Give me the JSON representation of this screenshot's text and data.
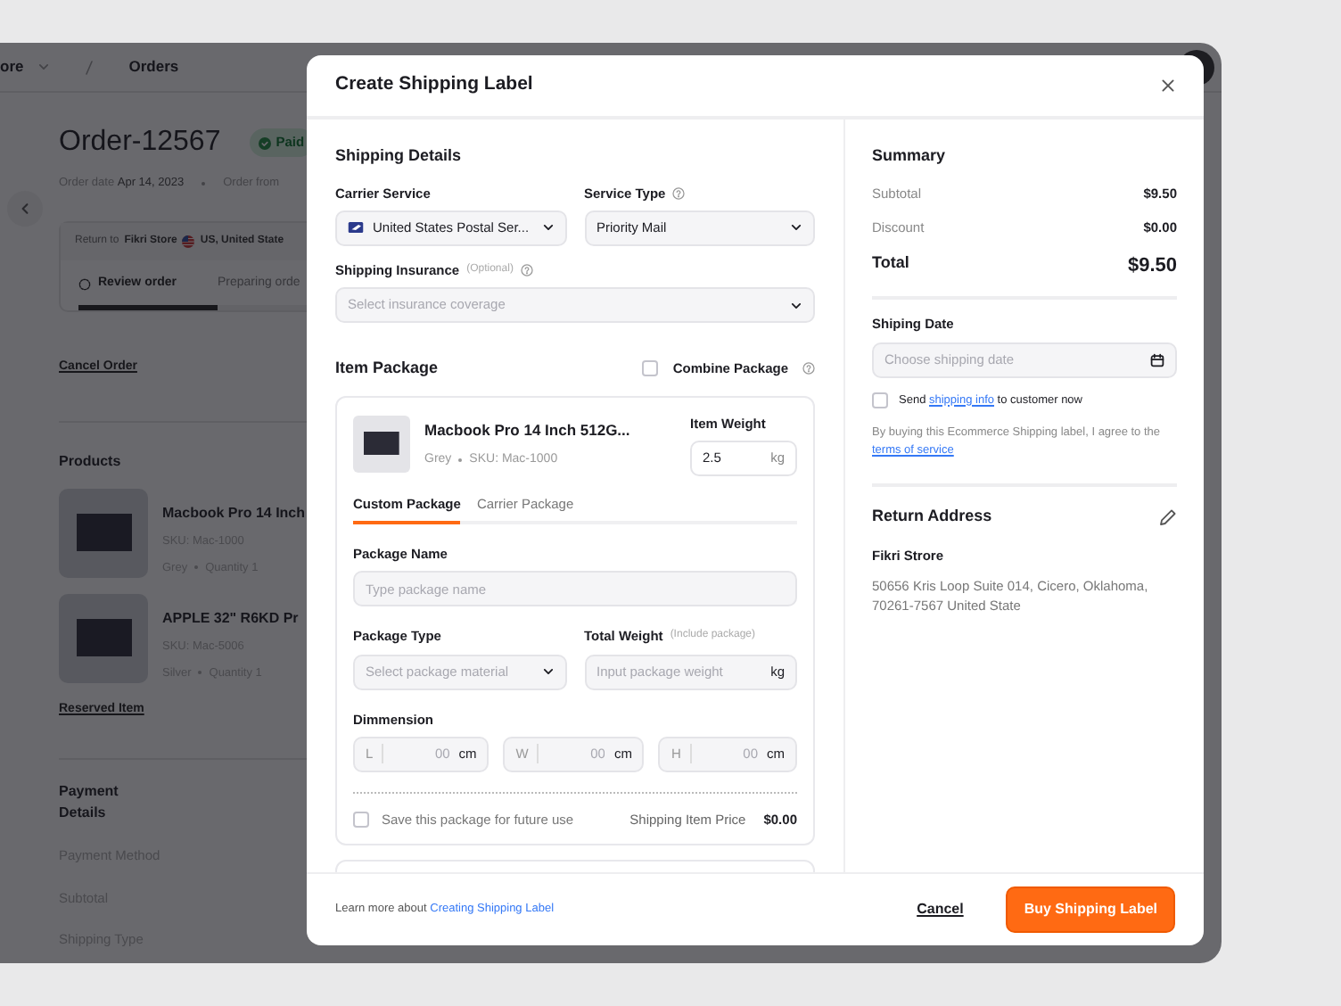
{
  "page": {
    "breadcrumb": [
      "ore",
      "Orders"
    ],
    "order_title": "Order-12567",
    "status_badge": "Paid",
    "order_meta": [
      {
        "label": "Order date",
        "value": "Apr 14, 2023"
      },
      {
        "label": "Order from"
      }
    ],
    "return_to": {
      "label": "Return to",
      "store": "Fikri Store",
      "country": "US, United State"
    },
    "steps": [
      {
        "label": "Review order",
        "selected": true
      },
      {
        "label": "Preparing orde",
        "selected": false
      }
    ],
    "cancel_link": "Cancel Order",
    "products_heading": "Products",
    "products": [
      {
        "name": "Macbook Pro 14 Inch",
        "sku": "SKU: Mac-1000",
        "variant": "Grey",
        "quantity": "Quantity 1"
      },
      {
        "name": "APPLE 32\" R6KD Pr",
        "sku": "SKU: Mac-5006",
        "variant": "Silver",
        "quantity": "Quantity 1"
      }
    ],
    "reserved_link": "Reserved Item",
    "payment_heading": "Payment Details",
    "payment_rows": [
      "Payment Method",
      "Subtotal",
      "Shipping Type"
    ]
  },
  "modal": {
    "title": "Create Shipping Label",
    "shipping_details": {
      "heading": "Shipping Details",
      "carrier": {
        "label": "Carrier Service",
        "value": "United States Postal Ser..."
      },
      "service_type": {
        "label": "Service Type",
        "value": "Priority Mail"
      },
      "insurance": {
        "label": "Shipping Insurance",
        "hint": "(Optional)",
        "placeholder": "Select insurance coverage"
      }
    },
    "item_package": {
      "heading": "Item Package",
      "combine": {
        "label": "Combine Package",
        "checked": false
      },
      "packages": [
        {
          "kind": "full",
          "name": "Macbook Pro 14 Inch 512G...",
          "variant": "Grey",
          "sku": "SKU: Mac-1000",
          "weight_label": "Item Weight",
          "weight": "2.5",
          "weight_unit": "kg",
          "tabs": [
            {
              "label": "Custom Package",
              "selected": true
            },
            {
              "label": "Carrier Package",
              "selected": false
            }
          ],
          "package_name": {
            "label": "Package Name",
            "placeholder": "Type package name"
          },
          "package_type": {
            "label": "Package Type",
            "placeholder": "Select package material"
          },
          "total_weight": {
            "label": "Total Weight",
            "hint": "(Include package)",
            "placeholder": "Input package weight",
            "unit": "kg"
          },
          "dimension": {
            "label": "Dimmension",
            "fields": [
              {
                "axis": "L",
                "placeholder": "00",
                "unit": "cm"
              },
              {
                "axis": "W",
                "placeholder": "00",
                "unit": "cm"
              },
              {
                "axis": "H",
                "placeholder": "00",
                "unit": "cm"
              }
            ]
          },
          "save": {
            "label": "Save this package for future use",
            "checked": false
          },
          "price_label": "Shipping Item Price",
          "price": "$0.00"
        },
        {
          "kind": "cut_off"
        }
      ]
    },
    "summary": {
      "heading": "Summary",
      "rows": [
        {
          "kind": "line",
          "label": "Subtotal",
          "value": "$9.50"
        },
        {
          "kind": "line",
          "label": "Discount",
          "value": "$0.00"
        },
        {
          "kind": "total",
          "label": "Total",
          "value": "$9.50"
        }
      ],
      "date": {
        "label": "Shiping Date",
        "placeholder": "Choose shipping date"
      },
      "notify": {
        "checked": false,
        "before": "Send",
        "link": "shipping info",
        "after": "to customer now"
      },
      "agreement": {
        "text": "By buying this Ecommerce Shipping label, I agree to the",
        "link": "terms of service"
      }
    },
    "return_address": {
      "heading": "Return Address",
      "name": "Fikri Strore",
      "address": "50656 Kris Loop Suite 014, Cicero, Oklahoma, 70261-7567 United State"
    },
    "footer": {
      "text": "Learn more about",
      "link": "Creating Shipping Label",
      "cancel": "Cancel",
      "submit": "Buy Shipping Label"
    }
  }
}
